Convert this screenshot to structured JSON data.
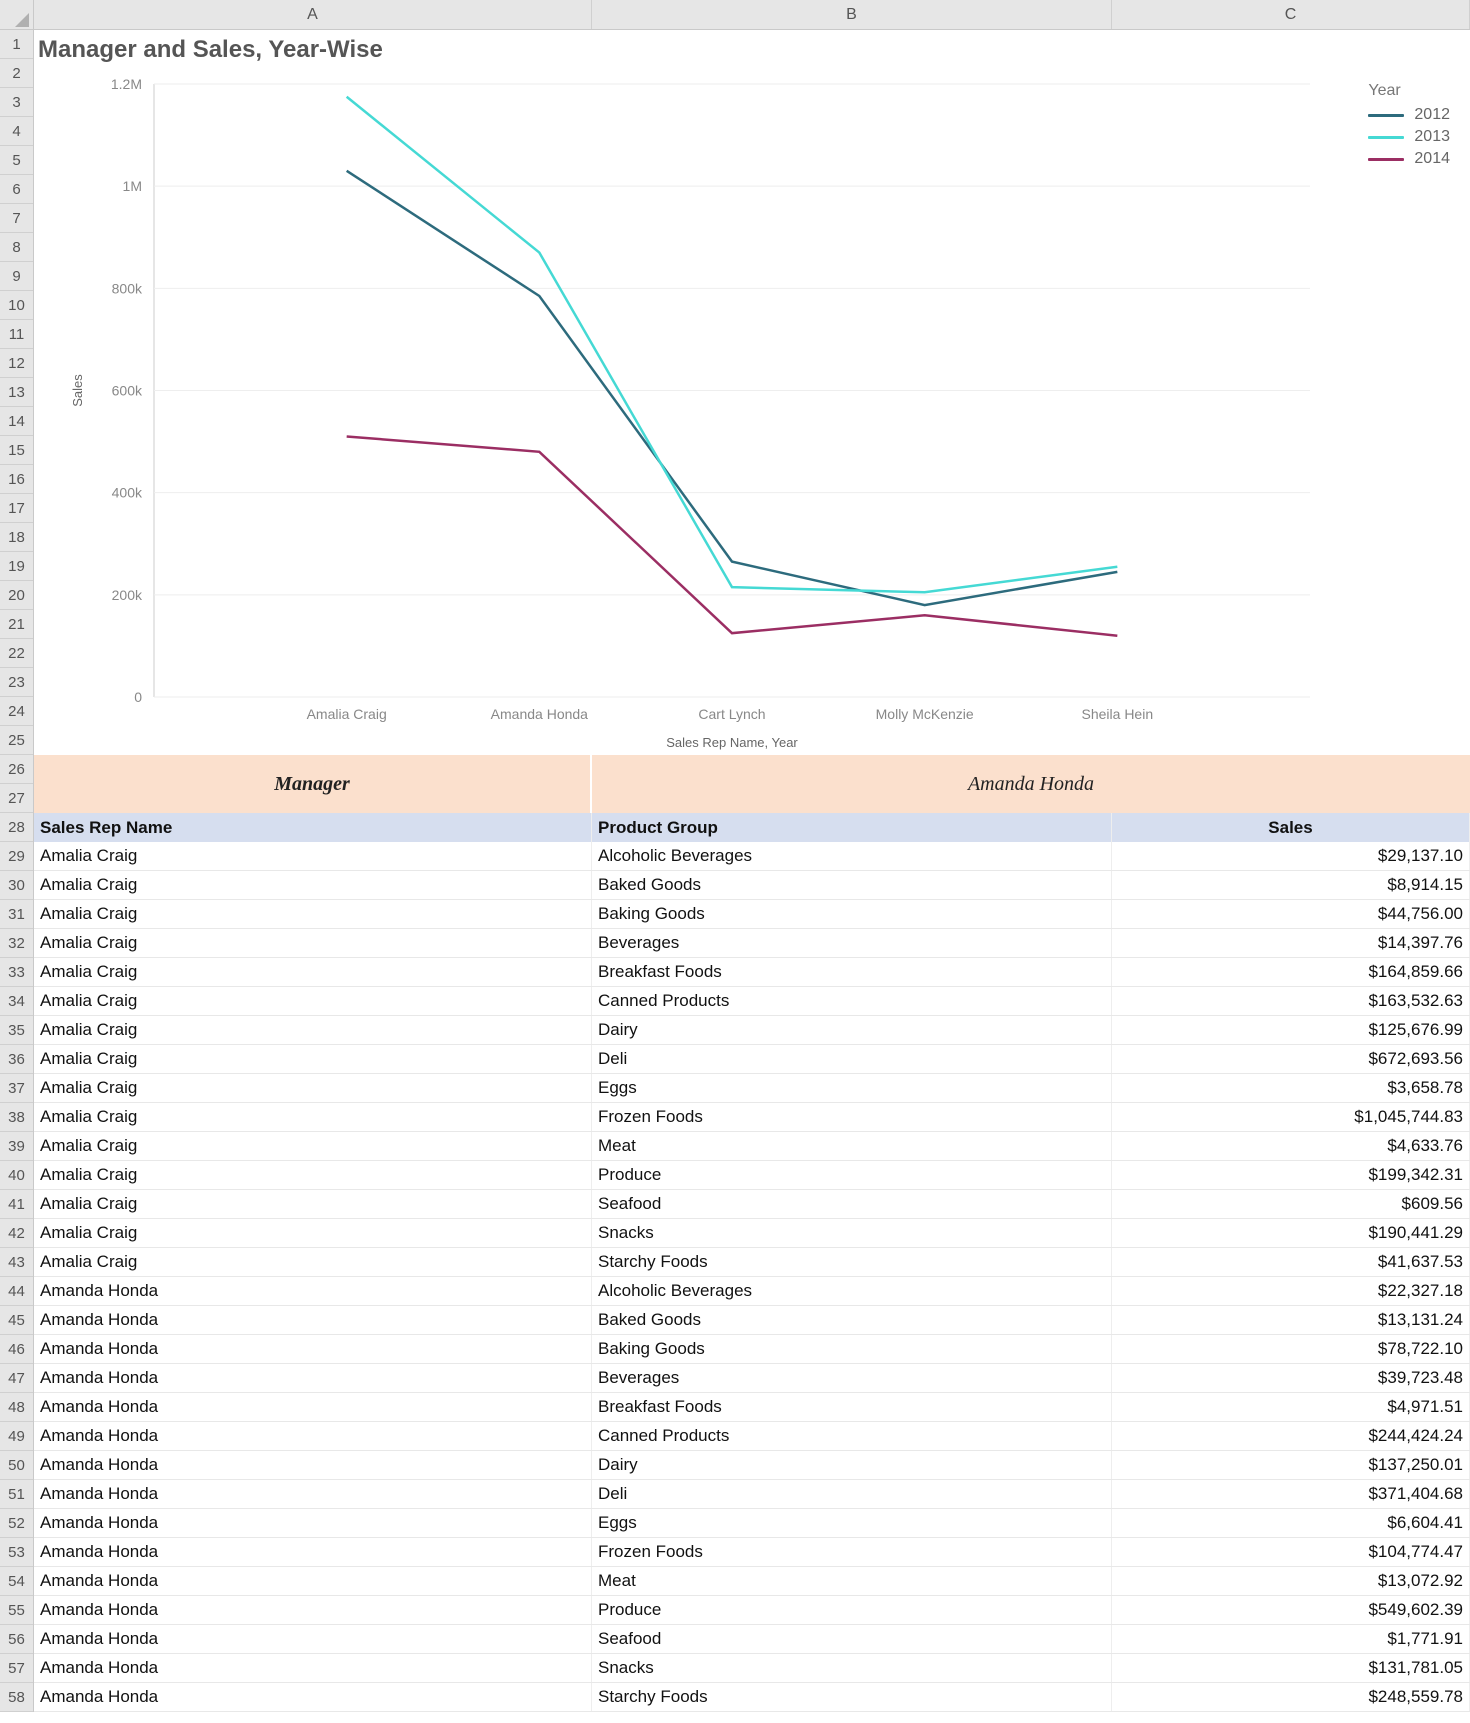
{
  "columns": {
    "labels": [
      "A",
      "B",
      "C"
    ],
    "widths": [
      558,
      520,
      358
    ]
  },
  "row_count": 58,
  "chart_data": {
    "type": "line",
    "title": "Manager and Sales, Year-Wise",
    "xlabel": "Sales Rep Name, Year",
    "ylabel": "Sales",
    "categories": [
      "Amalia Craig",
      "Amanda Honda",
      "Cart Lynch",
      "Molly McKenzie",
      "Sheila Hein"
    ],
    "y_ticks": [
      0,
      200000,
      400000,
      600000,
      800000,
      1000000,
      1200000
    ],
    "y_tick_labels": [
      "0",
      "200k",
      "400k",
      "600k",
      "800k",
      "1M",
      "1.2M"
    ],
    "ylim": [
      0,
      1200000
    ],
    "legend_title": "Year",
    "series": [
      {
        "name": "2012",
        "color": "#2d6b7d",
        "values": [
          1030000,
          785000,
          265000,
          180000,
          245000
        ]
      },
      {
        "name": "2013",
        "color": "#45d9d4",
        "values": [
          1175000,
          870000,
          215000,
          205000,
          255000
        ]
      },
      {
        "name": "2014",
        "color": "#9b2e63",
        "values": [
          510000,
          480000,
          125000,
          160000,
          120000
        ]
      }
    ]
  },
  "manager_band": {
    "label": "Manager",
    "value": "Amanda Honda"
  },
  "table": {
    "headers": [
      "Sales Rep Name",
      "Product Group",
      "Sales"
    ],
    "rows": [
      [
        "Amalia Craig",
        "Alcoholic Beverages",
        "$29,137.10"
      ],
      [
        "Amalia Craig",
        "Baked Goods",
        "$8,914.15"
      ],
      [
        "Amalia Craig",
        "Baking Goods",
        "$44,756.00"
      ],
      [
        "Amalia Craig",
        "Beverages",
        "$14,397.76"
      ],
      [
        "Amalia Craig",
        "Breakfast Foods",
        "$164,859.66"
      ],
      [
        "Amalia Craig",
        "Canned Products",
        "$163,532.63"
      ],
      [
        "Amalia Craig",
        "Dairy",
        "$125,676.99"
      ],
      [
        "Amalia Craig",
        "Deli",
        "$672,693.56"
      ],
      [
        "Amalia Craig",
        "Eggs",
        "$3,658.78"
      ],
      [
        "Amalia Craig",
        "Frozen Foods",
        "$1,045,744.83"
      ],
      [
        "Amalia Craig",
        "Meat",
        "$4,633.76"
      ],
      [
        "Amalia Craig",
        "Produce",
        "$199,342.31"
      ],
      [
        "Amalia Craig",
        "Seafood",
        "$609.56"
      ],
      [
        "Amalia Craig",
        "Snacks",
        "$190,441.29"
      ],
      [
        "Amalia Craig",
        "Starchy Foods",
        "$41,637.53"
      ],
      [
        "Amanda Honda",
        "Alcoholic Beverages",
        "$22,327.18"
      ],
      [
        "Amanda Honda",
        "Baked Goods",
        "$13,131.24"
      ],
      [
        "Amanda Honda",
        "Baking Goods",
        "$78,722.10"
      ],
      [
        "Amanda Honda",
        "Beverages",
        "$39,723.48"
      ],
      [
        "Amanda Honda",
        "Breakfast Foods",
        "$4,971.51"
      ],
      [
        "Amanda Honda",
        "Canned Products",
        "$244,424.24"
      ],
      [
        "Amanda Honda",
        "Dairy",
        "$137,250.01"
      ],
      [
        "Amanda Honda",
        "Deli",
        "$371,404.68"
      ],
      [
        "Amanda Honda",
        "Eggs",
        "$6,604.41"
      ],
      [
        "Amanda Honda",
        "Frozen Foods",
        "$104,774.47"
      ],
      [
        "Amanda Honda",
        "Meat",
        "$13,072.92"
      ],
      [
        "Amanda Honda",
        "Produce",
        "$549,602.39"
      ],
      [
        "Amanda Honda",
        "Seafood",
        "$1,771.91"
      ],
      [
        "Amanda Honda",
        "Snacks",
        "$131,781.05"
      ],
      [
        "Amanda Honda",
        "Starchy Foods",
        "$248,559.78"
      ]
    ]
  }
}
